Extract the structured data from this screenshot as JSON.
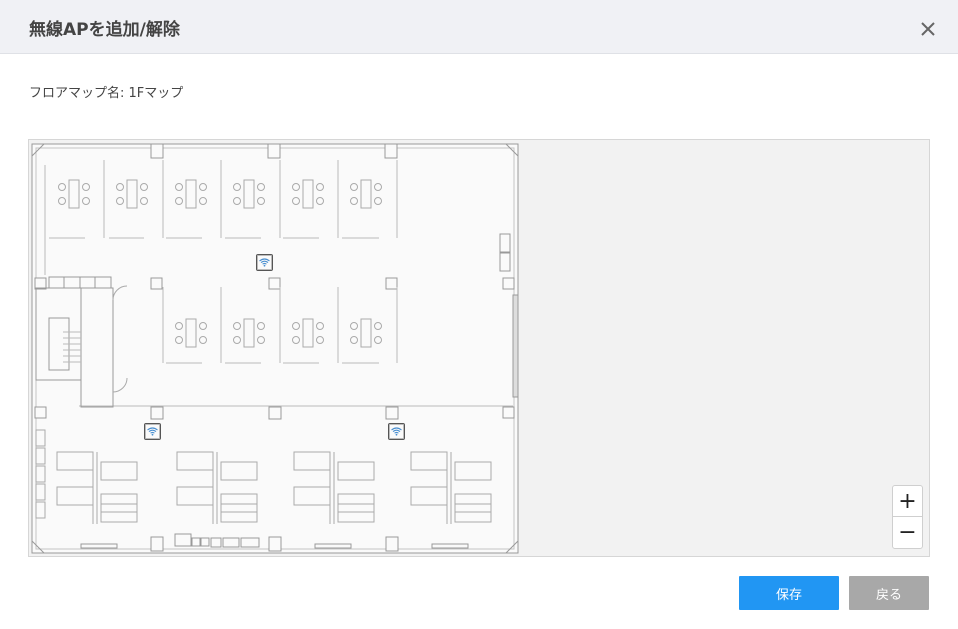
{
  "dialog": {
    "title": "無線APを追加/解除",
    "close_icon": "close-icon"
  },
  "floor_map": {
    "label_prefix": "フロアマップ名:",
    "name": "1Fマップ",
    "label": "フロアマップ名: 1Fマップ"
  },
  "map": {
    "access_points": [
      {
        "icon": "wifi-icon"
      },
      {
        "icon": "wifi-icon"
      },
      {
        "icon": "wifi-icon"
      }
    ],
    "zoom_in_label": "+",
    "zoom_out_label": "−"
  },
  "footer": {
    "save_label": "保存",
    "back_label": "戻る",
    "save_color": "#2196f3",
    "back_color": "#a8a8a8"
  }
}
